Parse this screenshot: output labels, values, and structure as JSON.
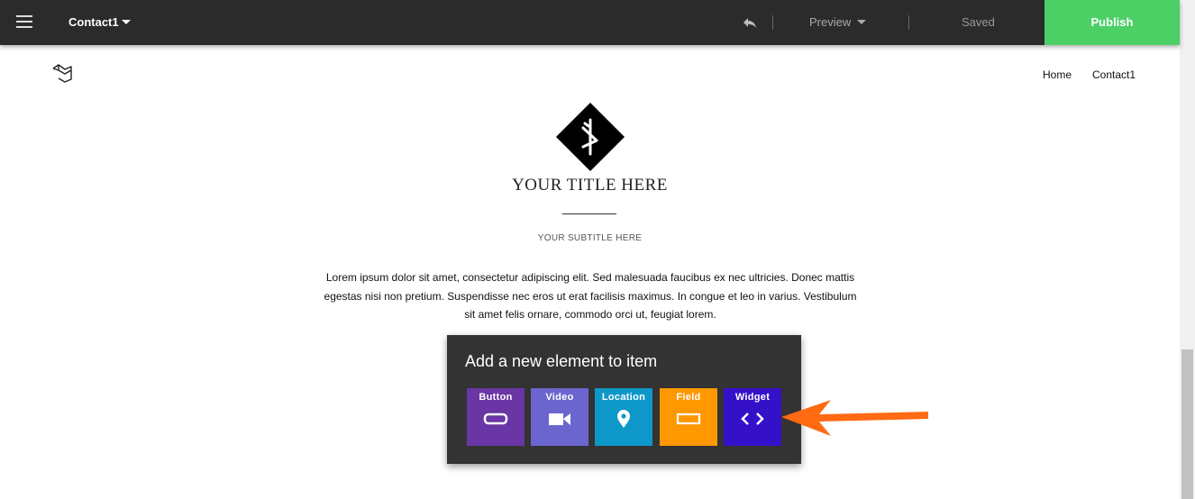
{
  "topbar": {
    "menu_icon": "hamburger-icon",
    "page_name": "Contact1",
    "undo_icon": "undo-icon",
    "preview_label": "Preview",
    "status": "Saved",
    "publish_label": "Publish",
    "publish_color": "#4cd066"
  },
  "nav": {
    "logo_icon": "logo-icon",
    "items": [
      "Home",
      "Contact1"
    ]
  },
  "hero": {
    "icon": "diamond-logo-icon",
    "title": "YOUR TITLE HERE",
    "subtitle": "YOUR SUBTITLE HERE",
    "body": "Lorem ipsum dolor sit amet, consectetur adipiscing elit. Sed malesuada faucibus ex nec ultricies. Donec mattis egestas nisi non pretium. Suspendisse nec eros ut erat facilisis maximus. In congue et leo in varius. Vestibulum sit amet felis ornare, commodo orci ut, feugiat lorem."
  },
  "panel": {
    "title": "Add a new element to item",
    "tiles": [
      {
        "label": "Button",
        "icon": "button-icon",
        "color": "#6a35a4"
      },
      {
        "label": "Video",
        "icon": "video-camera-icon",
        "color": "#6b66cf"
      },
      {
        "label": "Location",
        "icon": "map-pin-icon",
        "color": "#0e98c9"
      },
      {
        "label": "Field",
        "icon": "input-field-icon",
        "color": "#ff9800"
      },
      {
        "label": "Widget",
        "icon": "code-icon",
        "color": "#3510c9"
      }
    ]
  },
  "annotation": {
    "icon": "arrow-pointer-icon",
    "color": "#ff6a13"
  }
}
